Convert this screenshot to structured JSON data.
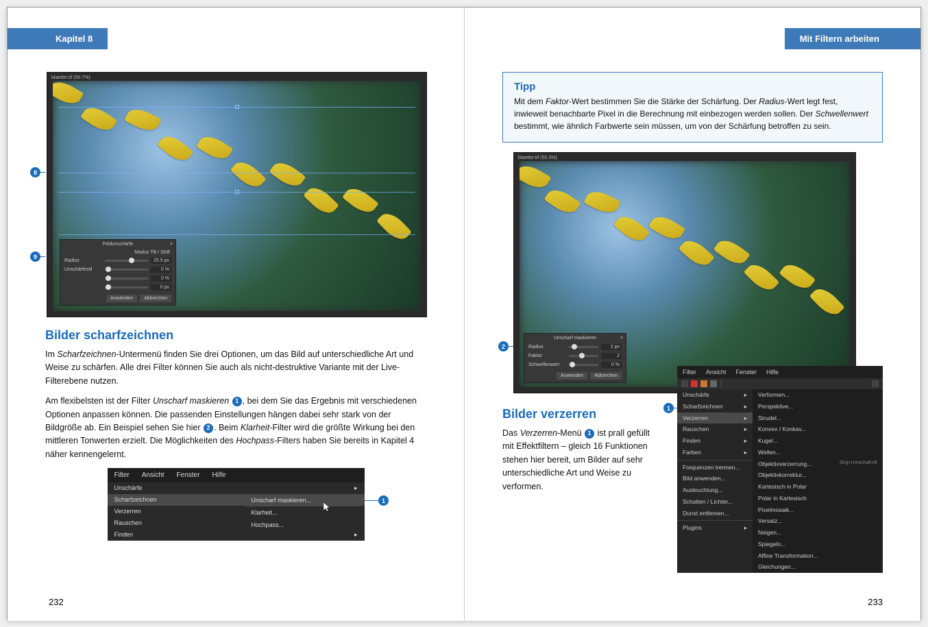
{
  "left": {
    "chapter": "Kapitel 8",
    "pageNum": "232",
    "hero": {
      "windowTitle": "blaetter.tif (50.7%)",
      "dialog": {
        "title": "Feldunschärfe",
        "modeLabel": "Modus Tilt / Shift",
        "rows": [
          {
            "label": "Radius",
            "value": "25.5 px",
            "knob": 55
          },
          {
            "label": "Unschärfestil",
            "value": "0 %",
            "knob": 2
          },
          {
            "label": "",
            "value": "0 %",
            "knob": 2
          },
          {
            "label": "",
            "value": "0 px",
            "knob": 2
          }
        ],
        "apply": "Anwenden",
        "cancel": "Abbrechen"
      },
      "callouts": {
        "c8": "8",
        "c9": "9"
      }
    },
    "h1": "Bilder scharfzeichnen",
    "p1_a": "Im ",
    "p1_i1": "Scharfzeichnen",
    "p1_b": "-Untermenü finden Sie drei Optionen, um das Bild auf unterschiedliche Art und Weise zu schärfen. Alle drei Filter können Sie auch als nicht-destruktive Variante mit der Live-Filterebene nutzen.",
    "p2_a": "Am flexibelsten ist der Filter ",
    "p2_i1": "Unscharf maskieren",
    "p2_b": ", bei dem Sie das Ergebnis mit verschiedenen Optionen anpassen können. Die passenden Einstellungen hängen dabei sehr stark von der Bildgröße ab. Ein Beispiel sehen Sie hier ",
    "p2_c": ". Beim ",
    "p2_i2": "Klarheit",
    "p2_d": "-Filter wird die größte Wirkung bei den mittleren Tonwerten erzielt. Die Möglichkeiten des ",
    "p2_i3": "Hochpass",
    "p2_e": "-Filters haben Sie bereits in Kapitel 4 näher kennengelernt.",
    "callout1": "1",
    "callout2": "2",
    "menu": {
      "top": [
        "Filter",
        "Ansicht",
        "Fenster",
        "Hilfe"
      ],
      "sub": [
        {
          "label": "Unschärfe",
          "arrow": "▸"
        },
        {
          "label": "Scharfzeichnen",
          "arrow": "▸",
          "hi": true
        },
        {
          "label": "Verzerren",
          "arrow": "▸"
        },
        {
          "label": "Rauschen",
          "arrow": "▸"
        },
        {
          "label": "Finden",
          "arrow": "▸"
        }
      ],
      "fly": [
        {
          "label": "Unscharf maskieren...",
          "hi": true
        },
        {
          "label": "Klarheit..."
        },
        {
          "label": "Hochpass..."
        }
      ],
      "calloutMenu": "1"
    }
  },
  "right": {
    "chapter": "Mit Filtern arbeiten",
    "pageNum": "233",
    "tip": {
      "title": "Tipp",
      "t_a": "Mit dem ",
      "t_i1": "Faktor",
      "t_b": "-Wert bestimmen Sie die Stärke der Schärfung. Der ",
      "t_i2": "Radius",
      "t_c": "-Wert legt fest, inwieweit benachbarte Pixel in die Berechnung mit einbezogen werden sollen. Der ",
      "t_i3": "Schwellenwert",
      "t_d": " bestimmt, wie ähnlich Farbwerte sein müssen, um von der Schärfung betroffen zu sein."
    },
    "hero": {
      "windowTitle": "blaetter.tif (50.3%)",
      "dialog": {
        "title": "Unscharf maskieren",
        "rows": [
          {
            "label": "Radius",
            "value": "2 px",
            "knob": 10
          },
          {
            "label": "Faktor",
            "value": "2",
            "knob": 35
          },
          {
            "label": "Schwellenwert",
            "value": "0 %",
            "knob": 2
          }
        ],
        "apply": "Anwenden",
        "cancel": "Abbrechen"
      },
      "callout": "2"
    },
    "h1": "Bilder verzerren",
    "p1_a": "Das ",
    "p1_i1": "Verzerren",
    "p1_b": "-Menü ",
    "p1_c": " ist prall gefüllt mit Effektfiltern – gleich 16 Funktionen stehen hier bereit, um Bilder auf sehr unterschiedliche Art und Weise zu verformen.",
    "callout1": "1",
    "bigmenu": {
      "top": [
        "Filter",
        "Ansicht",
        "Fenster",
        "Hilfe"
      ],
      "c1": [
        {
          "label": "Unschärfe",
          "arrow": "▸"
        },
        {
          "label": "Scharfzeichnen",
          "arrow": "▸"
        },
        {
          "label": "Verzerren",
          "arrow": "▸",
          "hi": true
        },
        {
          "label": "Rauschen",
          "arrow": "▸"
        },
        {
          "label": "Finden",
          "arrow": "▸"
        },
        {
          "label": "Farben",
          "arrow": "▸"
        },
        {
          "hr": true
        },
        {
          "label": "Frequenzen trennen..."
        },
        {
          "label": "Bild anwenden..."
        },
        {
          "label": "Ausleuchtung..."
        },
        {
          "label": "Schatten / Lichter..."
        },
        {
          "label": "Dunst entfernen..."
        },
        {
          "hr": true
        },
        {
          "label": "Plugins",
          "arrow": "▸"
        }
      ],
      "c2": [
        {
          "label": "Verformen..."
        },
        {
          "label": "Perspektive..."
        },
        {
          "label": "Strudel..."
        },
        {
          "label": "Konvex / Konkav..."
        },
        {
          "label": "Kugel..."
        },
        {
          "label": "Wellen..."
        },
        {
          "label": "Objektivverzerrung...",
          "sc": "Strg+Umschalt+R"
        },
        {
          "label": "Objektivkorrektur..."
        },
        {
          "label": "Kartesisch in Polar"
        },
        {
          "label": "Polar in Kartesisch"
        },
        {
          "label": "Pixelmosaik..."
        },
        {
          "label": "Versatz..."
        },
        {
          "label": "Neigen..."
        },
        {
          "label": "Spiegeln..."
        },
        {
          "label": "Affine Transformation..."
        },
        {
          "label": "Gleichungen..."
        }
      ],
      "callout": "1"
    }
  }
}
